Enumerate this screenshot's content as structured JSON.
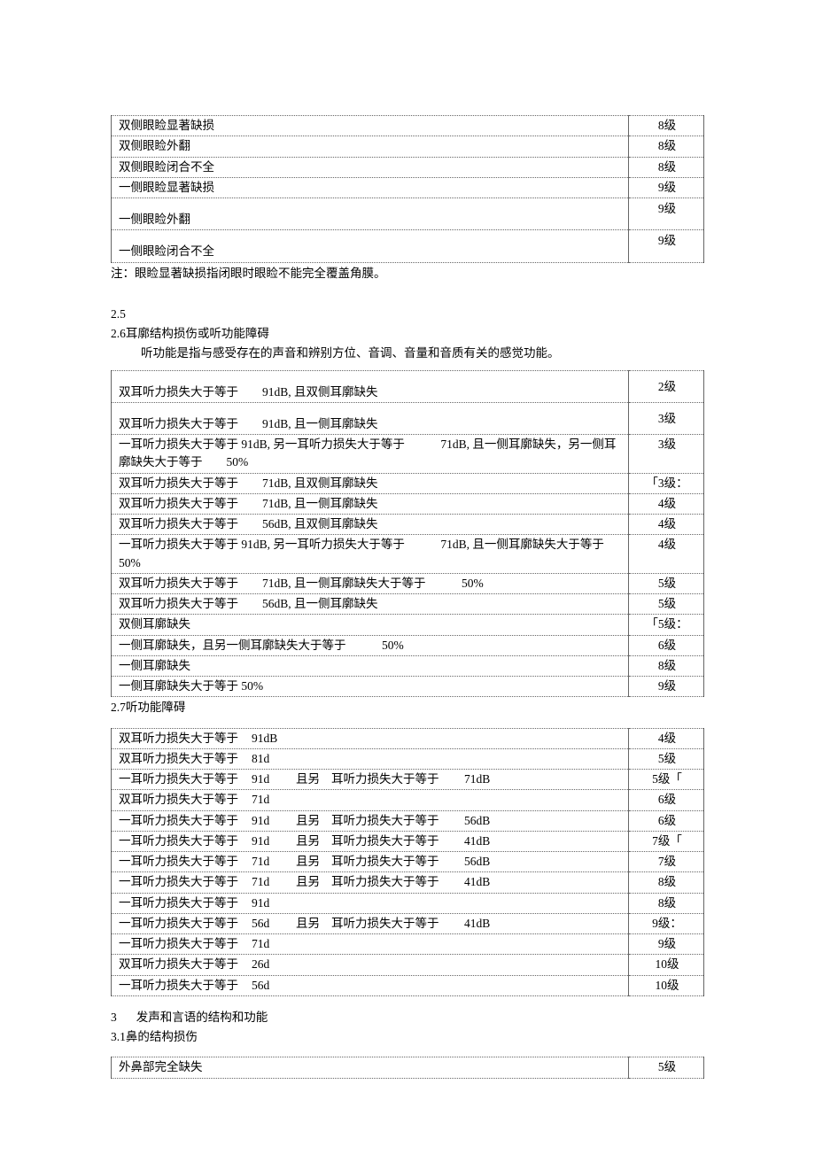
{
  "table1": {
    "rows": [
      {
        "desc": "双侧眼睑显著缺损",
        "grade": "8级",
        "tall": false
      },
      {
        "desc": "双侧眼睑外翻",
        "grade": "8级",
        "tall": false
      },
      {
        "desc": "双侧眼睑闭合不全",
        "grade": "8级",
        "tall": false
      },
      {
        "desc": "一侧眼睑显著缺损",
        "grade": "9级",
        "tall": false
      },
      {
        "desc": "一侧眼睑外翻",
        "grade": "9级",
        "tall": true
      },
      {
        "desc": "一侧眼睑闭合不全",
        "grade": "9级",
        "tall": true
      }
    ],
    "note": "注：眼睑显著缺损指闭眼时眼睑不能完全覆盖角膜。"
  },
  "sec25": "2.5",
  "sec26": {
    "num": "2.6",
    "title": "耳廓结构损伤或听功能障碍",
    "desc": "听功能是指与感受存在的声音和辨别方位、音调、音量和音质有关的感觉功能。"
  },
  "table2": {
    "rows": [
      {
        "desc": "双耳听力损失大于等于　　91dB, 且双侧耳廓缺失",
        "grade": "2级",
        "tall": true
      },
      {
        "desc": "双耳听力损失大于等于　　91dB, 且一侧耳廓缺失",
        "grade": "3级",
        "tall": true
      },
      {
        "desc": "一耳听力损失大于等于 91dB, 另一耳听力损失大于等于　　　71dB, 且一侧耳廓缺失，另一侧耳廓缺失大于等于　　50%",
        "grade": "3级",
        "tall": false
      },
      {
        "desc": "双耳听力损失大于等于　　71dB, 且双侧耳廓缺失",
        "grade": "「3级：",
        "tall": false
      },
      {
        "desc": "双耳听力损失大于等于　　71dB, 且一侧耳廓缺失",
        "grade": "4级",
        "tall": false
      },
      {
        "desc": "双耳听力损失大于等于　　56dB, 且双侧耳廓缺失",
        "grade": "4级",
        "tall": false
      },
      {
        "desc": "一耳听力损失大于等于 91dB, 另一耳听力损失大于等于　　　71dB, 且一侧耳廓缺失大于等于50%",
        "grade": "4级",
        "tall": false
      },
      {
        "desc": "双耳听力损失大于等于　　71dB, 且一侧耳廓缺失大于等于　　　50%",
        "grade": "5级",
        "tall": false
      },
      {
        "desc": "双耳听力损失大于等于　　56dB, 且一侧耳廓缺失",
        "grade": "5级",
        "tall": false
      },
      {
        "desc": "双侧耳廓缺失",
        "grade": "「5级：",
        "tall": false
      },
      {
        "desc": "一侧耳廓缺失，且另一侧耳廓缺失大于等于　　　50%",
        "grade": "6级",
        "tall": false
      },
      {
        "desc": "一侧耳廓缺失",
        "grade": "8级",
        "tall": false
      },
      {
        "desc": "一侧耳廓缺失大于等于 50%",
        "grade": "9级",
        "tall": false
      }
    ]
  },
  "sec27": {
    "num": "2.7",
    "title": "听功能障碍"
  },
  "table3": {
    "rows": [
      {
        "c1": "双耳听力损失大于等于",
        "c2": "91dB",
        "c3": "",
        "c4": "",
        "c5": "",
        "grade": "4级"
      },
      {
        "c1": "双耳听力损失大于等于",
        "c2": "81d",
        "c3": "",
        "c4": "",
        "c5": "",
        "grade": "5级"
      },
      {
        "c1": "一耳听力损失大于等于",
        "c2": "91d",
        "c3": "且另",
        "c4": "耳听力损失大于等于",
        "c5": "71dB",
        "grade": "5级「"
      },
      {
        "c1": "双耳听力损失大于等于",
        "c2": "71d",
        "c3": "",
        "c4": "",
        "c5": "",
        "grade": "6级"
      },
      {
        "c1": "一耳听力损失大于等于",
        "c2": "91d",
        "c3": "且另",
        "c4": "耳听力损失大于等于",
        "c5": "56dB",
        "grade": "6级"
      },
      {
        "c1": "一耳听力损失大于等于",
        "c2": "91d",
        "c3": "且另",
        "c4": "耳听力损失大于等于",
        "c5": "41dB",
        "grade": "7级「"
      },
      {
        "c1": "一耳听力损失大于等于",
        "c2": "71d",
        "c3": "且另",
        "c4": "耳听力损失大于等于",
        "c5": "56dB",
        "grade": "7级"
      },
      {
        "c1": "一耳听力损失大于等于",
        "c2": "71d",
        "c3": "且另",
        "c4": "耳听力损失大于等于",
        "c5": "41dB",
        "grade": "8级"
      },
      {
        "c1": "一耳听力损失大于等于",
        "c2": "91d",
        "c3": "",
        "c4": "",
        "c5": "",
        "grade": "8级"
      },
      {
        "c1": "一耳听力损失大于等于",
        "c2": "56d",
        "c3": "且另",
        "c4": "耳听力损失大于等于",
        "c5": "41dB",
        "grade": "9级："
      },
      {
        "c1": "一耳听力损失大于等于",
        "c2": "71d",
        "c3": "",
        "c4": "",
        "c5": "",
        "grade": "9级"
      },
      {
        "c1": "双耳听力损失大于等于",
        "c2": "26d",
        "c3": "",
        "c4": "",
        "c5": "",
        "grade": "10级"
      },
      {
        "c1": "一耳听力损失大于等于",
        "c2": "56d",
        "c3": "",
        "c4": "",
        "c5": "",
        "grade": "10级"
      }
    ]
  },
  "sec3": {
    "num": "3",
    "title": "发声和言语的结构和功能"
  },
  "sec31": {
    "num": "3.1",
    "title": "鼻的结构损伤"
  },
  "table4": {
    "rows": [
      {
        "desc": "外鼻部完全缺失",
        "grade": "5级"
      }
    ]
  }
}
